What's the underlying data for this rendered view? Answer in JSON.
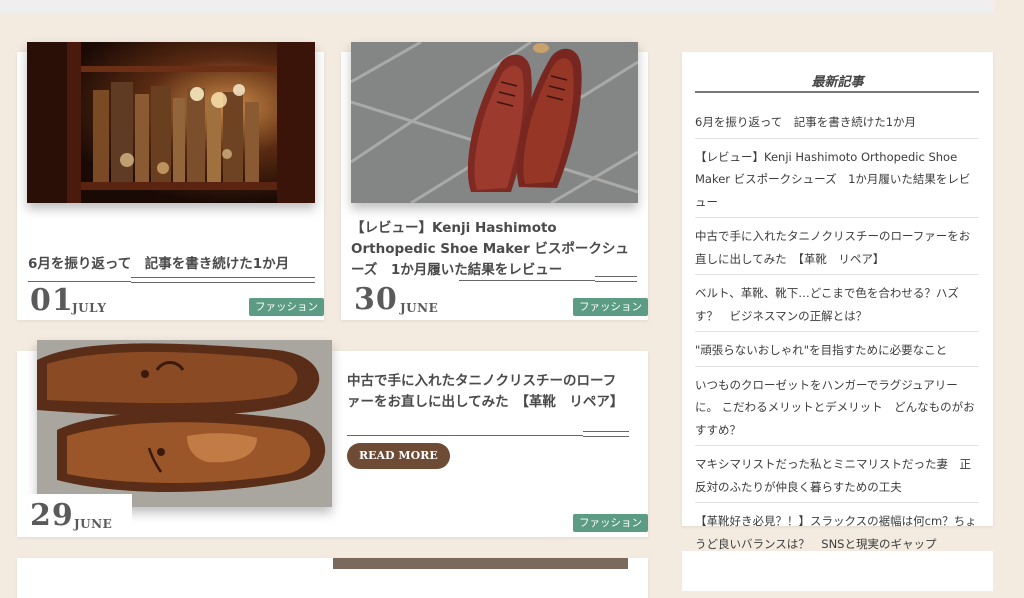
{
  "posts": [
    {
      "title": "6月を振り返って　記事を書き続けた1か月",
      "day": "01",
      "month": "JULY",
      "category": "ファッション",
      "image": "bookshelf-photo"
    },
    {
      "title": "【レビュー】Kenji Hashimoto Orthopedic Shoe Maker ビスポークシューズ　1か月履いた結果をレビュー",
      "day": "30",
      "month": "JUNE",
      "category": "ファッション",
      "image": "oxford-shoes-photo"
    },
    {
      "title": "中古で手に入れたタニノクリスチーのローファーをお直しに出してみた　【革靴　リペア】",
      "day": "29",
      "month": "JUNE",
      "category": "ファッション",
      "read_more": "READ MORE",
      "image": "loafers-photo"
    }
  ],
  "sidebar": {
    "title": "最新記事",
    "items": [
      "6月を振り返って　記事を書き続けた1か月",
      "【レビュー】Kenji Hashimoto Orthopedic Shoe Maker ビスポークシューズ　1か月履いた結果をレビュー",
      "中古で手に入れたタニノクリスチーのローファーをお直しに出してみた　【革靴　リペア】",
      "ベルト、革靴、靴下…どこまで色を合わせる？ハズす？　ビジネスマンの正解とは？",
      "\"頑張らないおしゃれ\"を目指すために必要なこと",
      "いつものクローゼットをハンガーでラグジュアリーに。 こだわるメリットとデメリット　どんなものがおすすめ？",
      "マキシマリストだった私とミニマリストだった妻　正反対のふたりが仲良く暮らすための工夫",
      "【革靴好き必見？！】スラックスの裾幅は何cm？ちょうど良いバランスは？　SNSと現実のギャップ"
    ]
  },
  "colors": {
    "background": "#f3ebe0",
    "category_tag": "#5d9c84",
    "read_more_button": "#6e4b34"
  }
}
